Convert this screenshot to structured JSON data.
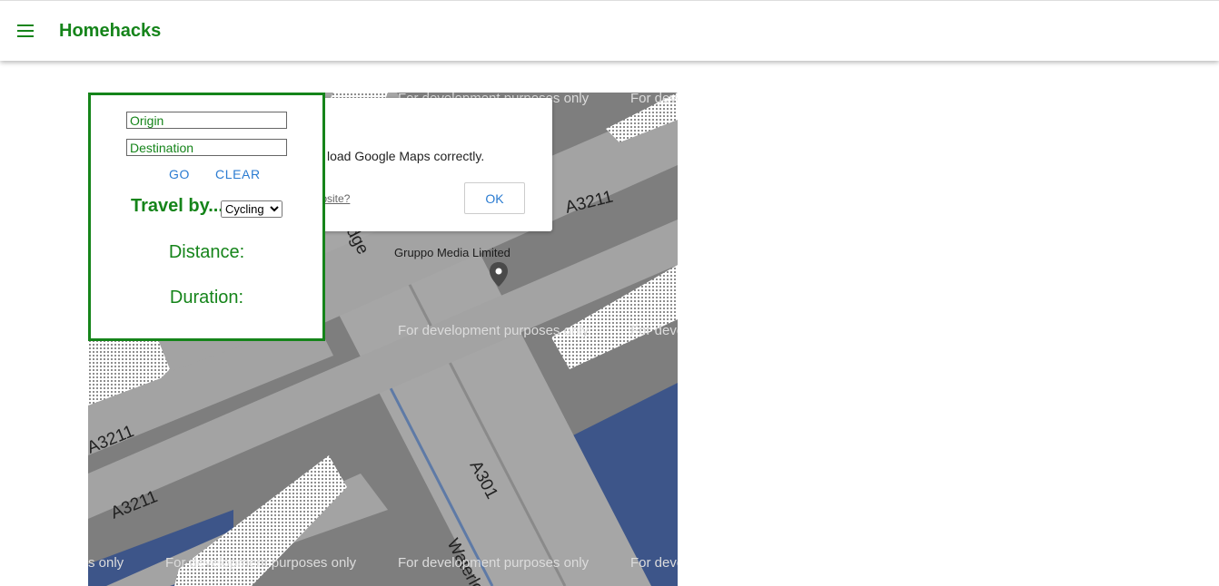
{
  "header": {
    "title": "Homehacks",
    "menu_icon": "hamburger-menu-icon"
  },
  "map": {
    "watermark": "For development purposes only",
    "watermark_partial_right": "For deve",
    "watermark_partial_left": "s only",
    "road_labels": [
      "A3211",
      "A3211",
      "A3211",
      "A301",
      "Waterlo",
      "idge"
    ],
    "place_label": "Gruppo Media Limited",
    "pin_icon": "map-pin-icon",
    "colors": {
      "road": "#a5a5a5",
      "background": "#7e7e7e",
      "water": "#3d5589"
    }
  },
  "dialog": {
    "message": "load Google Maps correctly.",
    "link": "website?",
    "ok_label": "OK"
  },
  "panel": {
    "origin_placeholder": "Origin",
    "destination_placeholder": "Destination",
    "go_label": "GO",
    "clear_label": "CLEAR",
    "travel_label": "Travel by...",
    "travel_selected": "Cycling",
    "distance_label": "Distance:",
    "duration_label": "Duration:"
  },
  "colors": {
    "accent": "#15841a",
    "link": "#2a7bd1"
  }
}
